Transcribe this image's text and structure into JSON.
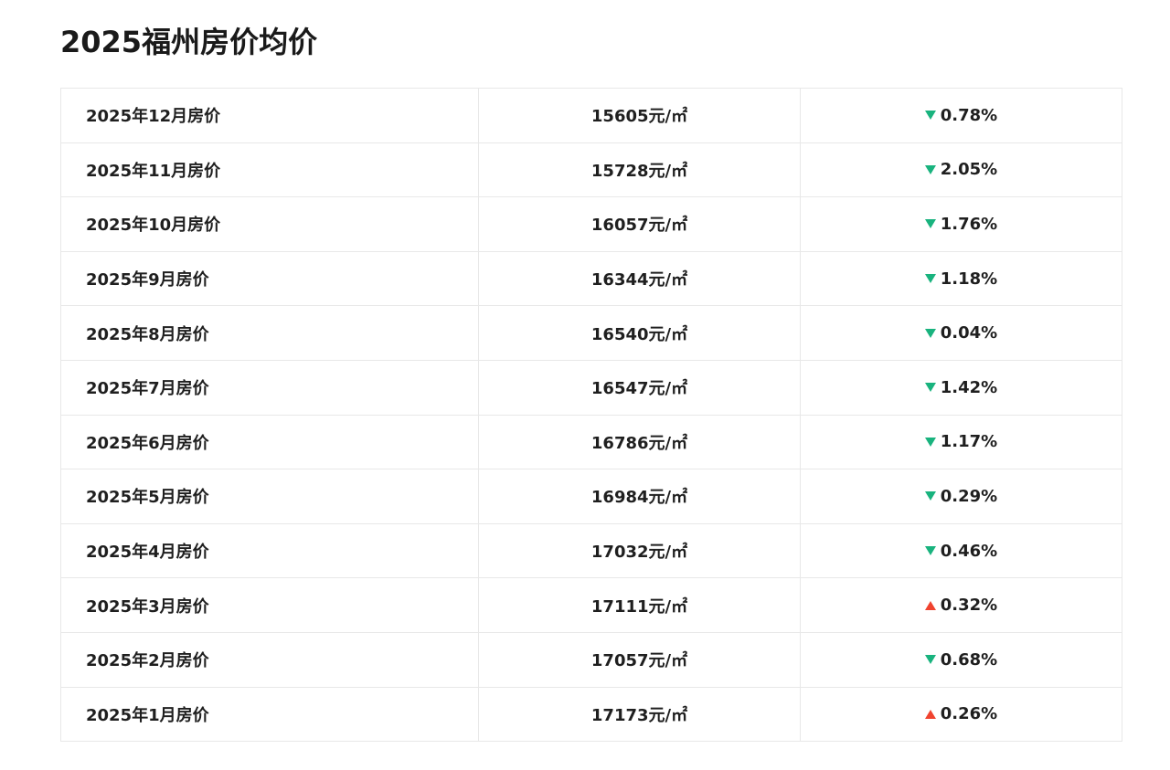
{
  "page": {
    "title": "2025福州房价均价"
  },
  "colors": {
    "down": "#19b37e",
    "up": "#f0432f"
  },
  "rows": [
    {
      "month": "2025年12月房价",
      "price": "15605元/㎡",
      "direction": "down",
      "change": "0.78%"
    },
    {
      "month": "2025年11月房价",
      "price": "15728元/㎡",
      "direction": "down",
      "change": "2.05%"
    },
    {
      "month": "2025年10月房价",
      "price": "16057元/㎡",
      "direction": "down",
      "change": "1.76%"
    },
    {
      "month": "2025年9月房价",
      "price": "16344元/㎡",
      "direction": "down",
      "change": "1.18%"
    },
    {
      "month": "2025年8月房价",
      "price": "16540元/㎡",
      "direction": "down",
      "change": "0.04%"
    },
    {
      "month": "2025年7月房价",
      "price": "16547元/㎡",
      "direction": "down",
      "change": "1.42%"
    },
    {
      "month": "2025年6月房价",
      "price": "16786元/㎡",
      "direction": "down",
      "change": "1.17%"
    },
    {
      "month": "2025年5月房价",
      "price": "16984元/㎡",
      "direction": "down",
      "change": "0.29%"
    },
    {
      "month": "2025年4月房价",
      "price": "17032元/㎡",
      "direction": "down",
      "change": "0.46%"
    },
    {
      "month": "2025年3月房价",
      "price": "17111元/㎡",
      "direction": "up",
      "change": "0.32%"
    },
    {
      "month": "2025年2月房价",
      "price": "17057元/㎡",
      "direction": "down",
      "change": "0.68%"
    },
    {
      "month": "2025年1月房价",
      "price": "17173元/㎡",
      "direction": "up",
      "change": "0.26%"
    }
  ]
}
